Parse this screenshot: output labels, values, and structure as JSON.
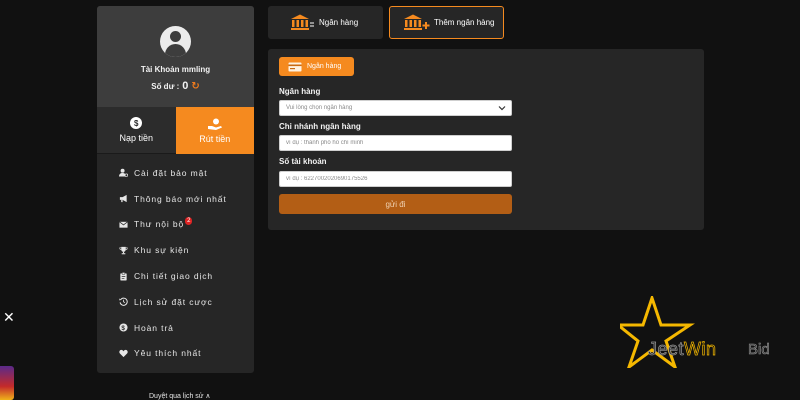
{
  "profile": {
    "account_label": "Tài Khoản mmling",
    "balance_label": "Số dư :",
    "balance_value": "0"
  },
  "actions": {
    "deposit_label": "Nạp tiền",
    "withdraw_label": "Rút tiền"
  },
  "menu": {
    "items": [
      {
        "label": "Cài đặt bảo mật",
        "icon": "user-cog-icon"
      },
      {
        "label": "Thông báo mới nhất",
        "icon": "megaphone-icon"
      },
      {
        "label": "Thư nội bộ",
        "icon": "mail-icon",
        "badge": "2"
      },
      {
        "label": "Khu sự kiện",
        "icon": "trophy-icon"
      },
      {
        "label": "Chi tiết giao dịch",
        "icon": "clipboard-icon"
      },
      {
        "label": "Lịch sử đặt cược",
        "icon": "history-icon"
      },
      {
        "label": "Hoàn trả",
        "icon": "dollar-circle-icon"
      },
      {
        "label": "Yêu thích nhất",
        "icon": "heart-icon"
      }
    ]
  },
  "tabs": {
    "bank_label": "Ngân hàng",
    "add_bank_label": "Thêm ngân hàng"
  },
  "form": {
    "chip_label": "Ngân hàng",
    "bank_label": "Ngân hàng",
    "bank_select_value": "Vui lòng chọn ngân hàng",
    "branch_label": "Chi nhánh ngân hàng",
    "branch_placeholder": "ví dụ : thành phố hồ chí minh",
    "account_label": "Số tài khoản",
    "account_placeholder": "ví dụ : 6227002020690175526",
    "submit_label": "gửi đi"
  },
  "footer": {
    "text": "Duyệt qua lịch sử ∧"
  },
  "logo": {
    "part1": "Jeet",
    "part2": "Win",
    "suffix": "Bid"
  },
  "colors": {
    "accent": "#f58a1f",
    "submit": "#b35e15",
    "panel": "#262626",
    "background": "#111111"
  }
}
